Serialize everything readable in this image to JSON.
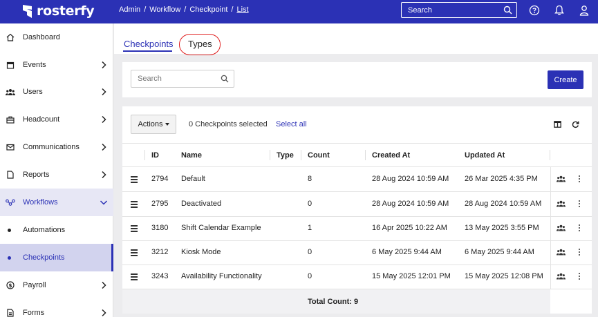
{
  "app": {
    "name": "rosterfy",
    "brand_color": "#2b31b5",
    "alert_color": "#e02020"
  },
  "breadcrumb": [
    "Admin",
    "Workflow",
    "Checkpoint",
    "List"
  ],
  "header": {
    "search_placeholder": "Search",
    "icons": [
      "help-icon",
      "bell-icon",
      "user-icon"
    ]
  },
  "sidebar": {
    "items": [
      {
        "label": "Dashboard",
        "icon": "home-icon",
        "has_chevron": false
      },
      {
        "label": "Events",
        "icon": "calendar-icon",
        "has_chevron": true
      },
      {
        "label": "Users",
        "icon": "users-icon",
        "has_chevron": true
      },
      {
        "label": "Headcount",
        "icon": "briefcase-icon",
        "has_chevron": true
      },
      {
        "label": "Communications",
        "icon": "envelope-icon",
        "has_chevron": true
      },
      {
        "label": "Reports",
        "icon": "file-icon",
        "has_chevron": true
      },
      {
        "label": "Workflows",
        "icon": "workflow-icon",
        "has_chevron": true,
        "expanded": true
      },
      {
        "label": "Automations",
        "sub": true
      },
      {
        "label": "Checkpoints",
        "sub": true,
        "active": true
      },
      {
        "label": "Payroll",
        "icon": "dollar-icon",
        "has_chevron": true
      },
      {
        "label": "Forms",
        "icon": "document-icon",
        "has_chevron": true
      }
    ]
  },
  "tabs": [
    {
      "label": "Checkpoints",
      "active": true
    },
    {
      "label": "Types",
      "active": false
    }
  ],
  "toolbar": {
    "search_placeholder": "Search",
    "create_label": "Create"
  },
  "table_toolbar": {
    "actions_label": "Actions",
    "selected_text": "0 Checkpoints selected",
    "select_all_label": "Select all"
  },
  "table": {
    "columns": [
      "ID",
      "Name",
      "Type",
      "Count",
      "Created At",
      "Updated At"
    ],
    "rows": [
      {
        "id": "2794",
        "name": "Default",
        "type": "",
        "count": "8",
        "created": "28 Aug 2024 10:59 AM",
        "updated": "26 Mar 2025 4:35 PM"
      },
      {
        "id": "2795",
        "name": "Deactivated",
        "type": "",
        "count": "0",
        "created": "28 Aug 2024 10:59 AM",
        "updated": "28 Aug 2024 10:59 AM"
      },
      {
        "id": "3180",
        "name": "Shift Calendar Example",
        "type": "",
        "count": "1",
        "created": "16 Apr 2025 10:22 AM",
        "updated": "13 May 2025 3:55 PM"
      },
      {
        "id": "3212",
        "name": "Kiosk Mode",
        "type": "",
        "count": "0",
        "created": "6 May 2025 9:44 AM",
        "updated": "6 May 2025 9:44 AM"
      },
      {
        "id": "3243",
        "name": "Availability Functionality",
        "type": "",
        "count": "0",
        "created": "15 May 2025 12:01 PM",
        "updated": "15 May 2025 12:08 PM"
      }
    ],
    "total_label": "Total Count: 9"
  }
}
